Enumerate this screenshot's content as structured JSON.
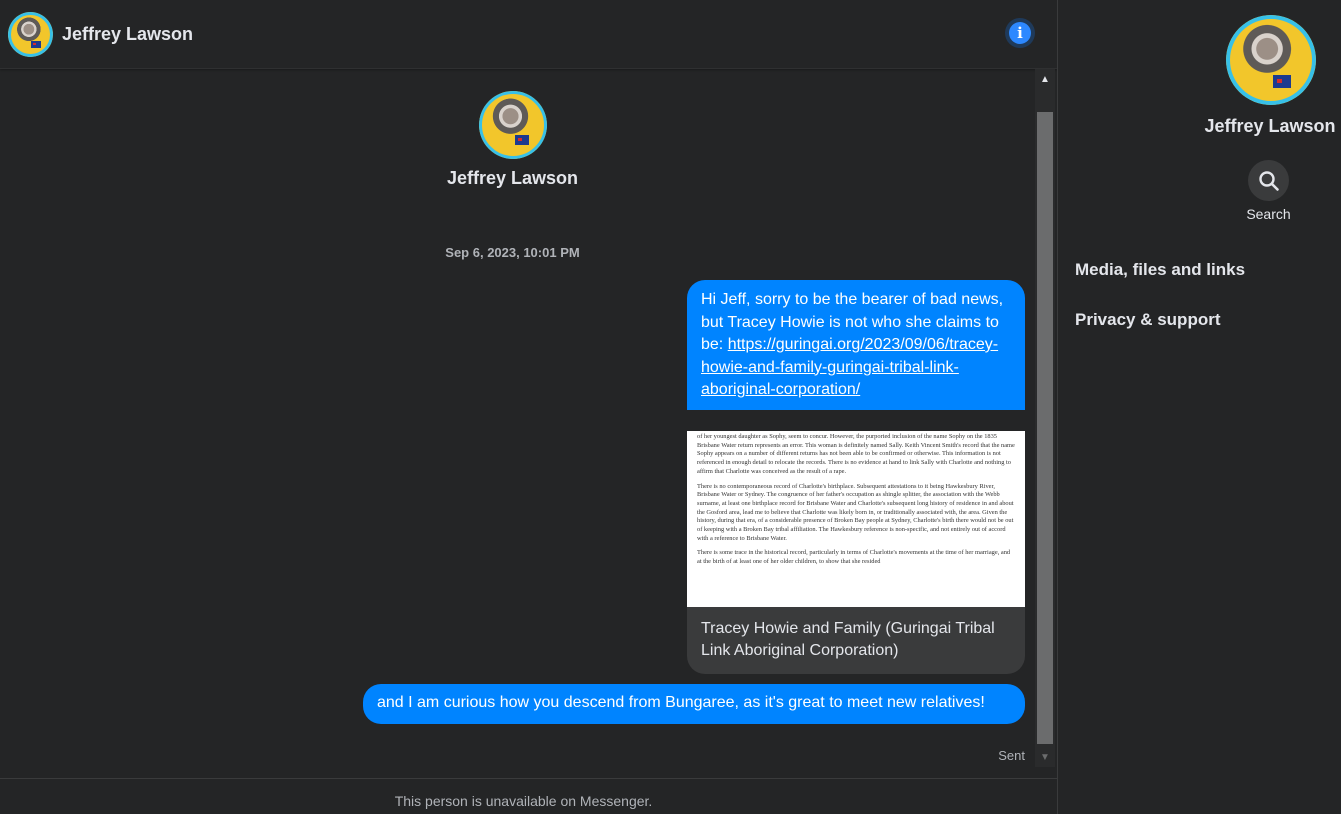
{
  "header": {
    "contact_name": "Jeffrey Lawson",
    "info_icon": "info-icon"
  },
  "conversation": {
    "contact_name": "Jeffrey Lawson",
    "timestamp": "Sep 6, 2023, 10:01 PM",
    "messages": [
      {
        "text": "Hi Jeff, sorry to be the bearer of bad news, but Tracey Howie is not who she claims to be:",
        "link": "https://guringai.org/2023/09/06/tracey-howie-and-family-guringai-tribal-link-aboriginal-corporation/",
        "preview": {
          "paragraphs": [
            "of her youngest daughter as Sophy, seem to concur. However, the purported inclusion of the name Sophy on the 1835 Brisbane Water return represents an error. This woman is definitely named Sally. Keith Vincent Smith's record that the name Sophy appears on a number of different returns has not been able to be confirmed or otherwise. This information is not referenced in enough detail to relocate the records. There is no evidence at hand to link Sally with Charlotte and nothing to affirm that Charlotte was conceived as the result of a rape.",
            "There is no contemporaneous record of Charlotte's birthplace. Subsequent attestations to it being Hawkesbury River, Brisbane Water or Sydney. The congruence of her father's occupation as shingle splitter, the association with the Webb surname, at least one birthplace record for Brisbane Water and Charlotte's subsequent long history of residence in and about the Gosford area, lead me to believe that Charlotte was likely born in, or traditionally associated with, the area. Given the history, during that era, of a considerable presence of Broken Bay people at Sydney, Charlotte's birth there would not be out of keeping with a Broken Bay tribal affiliation. The Hawkesbury reference is non-specific, and not entirely out of accord with a reference to Brisbane Water.",
            "There is some trace in the historical record, particularly in terms of Charlotte's movements at the time of her marriage, and at the birth of at least one of her older children, to show that she resided"
          ],
          "title": "Tracey Howie and Family (Guringai Tribal Link Aboriginal Corporation)"
        }
      },
      {
        "text": "and I am curious how you descend from Bungaree, as it's great to meet new relatives!"
      }
    ],
    "status": "Sent"
  },
  "footer": {
    "notice": "This person is unavailable on Messenger."
  },
  "sidebar": {
    "contact_name": "Jeffrey Lawson",
    "search_label": "Search",
    "items": [
      {
        "label": "Media, files and links"
      },
      {
        "label": "Privacy & support"
      }
    ]
  },
  "colors": {
    "background": "#242526",
    "outgoing_bubble": "#0084ff",
    "accent": "#2d88ff",
    "secondary_text": "#b0b3b8"
  }
}
